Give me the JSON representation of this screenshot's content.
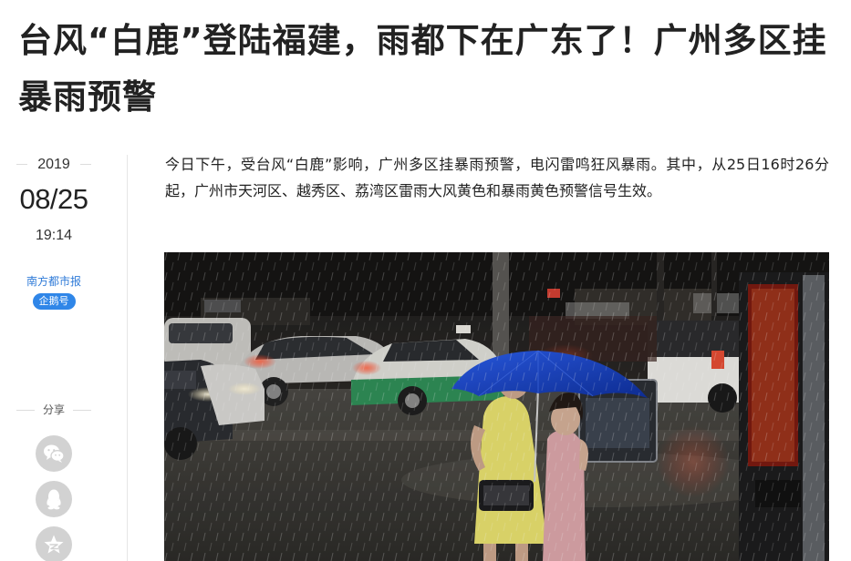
{
  "article": {
    "title": "台风“白鹿”登陆福建，雨都下在广东了！广州多区挂暴雨预警",
    "paragraph": "今日下午，受台风“白鹿”影响，广州多区挂暴雨预警，电闪雷鸣狂风暴雨。其中，从25日16时26分起，广州市天河区、越秀区、荔湾区雷雨大风黄色和暴雨黄色预警信号生效。"
  },
  "meta": {
    "year": "2019",
    "date": "08/25",
    "time": "19:14",
    "source": "南方都市报",
    "badge": "企鹅号"
  },
  "share": {
    "label": "分享",
    "buttons": [
      {
        "icon": "wechat-icon"
      },
      {
        "icon": "qq-icon"
      },
      {
        "icon": "qzone-star-icon"
      }
    ]
  },
  "colors": {
    "link_blue": "#2f7bd8",
    "badge_blue": "#2f86e8",
    "share_grey": "#d2d2d2",
    "umbrella_blue": "#1f4fd6"
  }
}
